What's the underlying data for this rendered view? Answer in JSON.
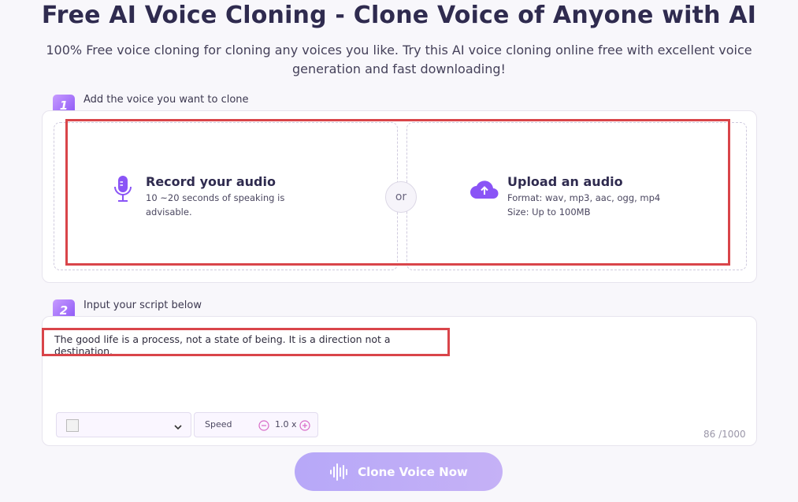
{
  "header": {
    "title": "Free AI Voice Cloning - Clone Voice of Anyone with AI",
    "subtitle": "100% Free voice cloning for cloning any voices you like. Try this AI voice cloning online free with excellent voice generation and fast downloading!"
  },
  "step1": {
    "number": "1",
    "label": "Add the voice you want to clone",
    "record": {
      "title": "Record your audio",
      "desc": "10 ~20 seconds of speaking is advisable.",
      "icon": "microphone-icon"
    },
    "or_label": "or",
    "upload": {
      "title": "Upload an audio",
      "format": "Format: wav, mp3, aac, ogg, mp4",
      "size": "Size: Up to 100MB",
      "icon": "cloud-upload-icon"
    }
  },
  "step2": {
    "number": "2",
    "label": "Input your script below",
    "script": "The good life is a process, not a state of being. It is a direction not a destination.",
    "speed_label": "Speed",
    "speed_value": "1.0 x",
    "counter": "86 /1000"
  },
  "clone_button": {
    "label": "Clone Voice Now",
    "icon": "soundwave-icon"
  },
  "colors": {
    "accent": "#8a54f6",
    "highlight": "#d9454a",
    "button": "#b7a8f8"
  }
}
